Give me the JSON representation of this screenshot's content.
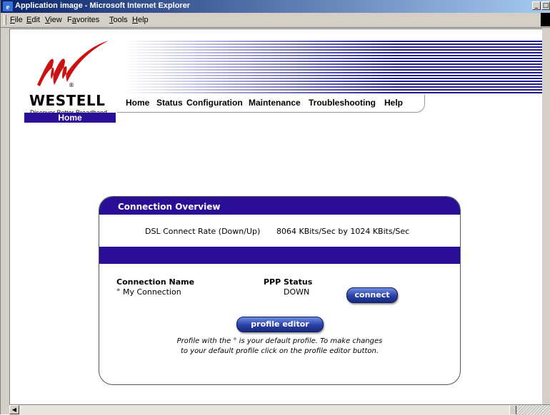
{
  "window": {
    "title": "Application image - Microsoft Internet Explorer",
    "menu": [
      "File",
      "Edit",
      "View",
      "Favorites",
      "Tools",
      "Help"
    ],
    "menu_accel": [
      "F",
      "E",
      "V",
      "a",
      "T",
      "H"
    ]
  },
  "brand": {
    "name": "WESTELL",
    "tagline": "Discover Better Broadband",
    "registered": "®"
  },
  "nav": {
    "items": [
      "Home",
      "Status",
      "Configuration",
      "Maintenance",
      "Troubleshooting",
      "Help"
    ],
    "current": "Home"
  },
  "overview": {
    "title": "Connection Overview",
    "dsl_label": "DSL Connect Rate (Down/Up)",
    "dsl_value": "8064 KBits/Sec by 1024 KBits/Sec",
    "col_name_header": "Connection Name",
    "col_status_header": "PPP Status",
    "connection_name": "° My Connection",
    "ppp_status": "DOWN",
    "connect_button": "connect",
    "profile_editor_button": "profile editor",
    "help_line1": "Profile with the ° is your default profile. To make changes",
    "help_line2": "to your default profile click on the profile editor button."
  },
  "colors": {
    "accent": "#2a0e96",
    "logo_red": "#cc1111"
  }
}
